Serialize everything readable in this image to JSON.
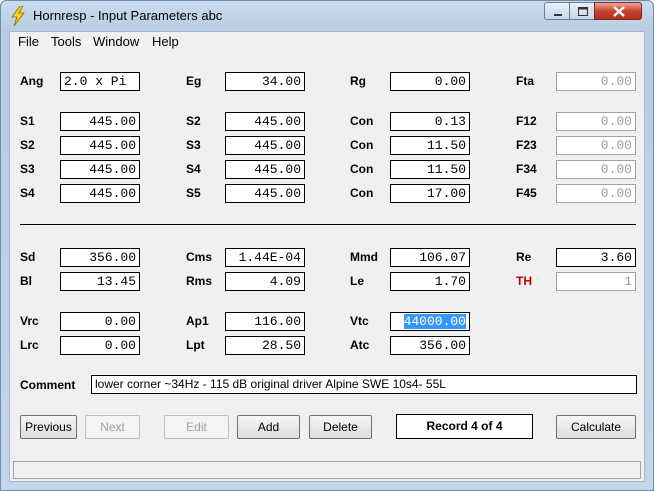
{
  "window": {
    "title": "Hornresp - Input Parameters   abc"
  },
  "menu": [
    "File",
    "Tools",
    "Window",
    "Help"
  ],
  "row_ang": {
    "ang_label": "Ang",
    "ang_value": "2.0 x Pi",
    "eg_label": "Eg",
    "eg_value": "34.00",
    "rg_label": "Rg",
    "rg_value": "0.00",
    "fta_label": "Fta",
    "fta_value": "0.00"
  },
  "rows": [
    {
      "a": "S1",
      "av": "445.00",
      "b": "S2",
      "bv": "445.00",
      "c": "Con",
      "cv": "0.13",
      "d": "F12",
      "dv": "0.00"
    },
    {
      "a": "S2",
      "av": "445.00",
      "b": "S3",
      "bv": "445.00",
      "c": "Con",
      "cv": "11.50",
      "d": "F23",
      "dv": "0.00"
    },
    {
      "a": "S3",
      "av": "445.00",
      "b": "S4",
      "bv": "445.00",
      "c": "Con",
      "cv": "11.50",
      "d": "F34",
      "dv": "0.00"
    },
    {
      "a": "S4",
      "av": "445.00",
      "b": "S5",
      "bv": "445.00",
      "c": "Con",
      "cv": "17.00",
      "d": "F45",
      "dv": "0.00"
    }
  ],
  "driver": {
    "sd_label": "Sd",
    "sd": "356.00",
    "cms_label": "Cms",
    "cms": "1.44E-04",
    "mmd_label": "Mmd",
    "mmd": "106.07",
    "re_label": "Re",
    "re": "3.60",
    "bl_label": "Bl",
    "bl": "13.45",
    "rms_label": "Rms",
    "rms": "4.09",
    "le_label": "Le",
    "le": "1.70",
    "th_label": "TH",
    "th": "1"
  },
  "chamber": {
    "vrc_label": "Vrc",
    "vrc": "0.00",
    "ap1_label": "Ap1",
    "ap1": "116.00",
    "vtc_label": "Vtc",
    "vtc": "44000.00",
    "lrc_label": "Lrc",
    "lrc": "0.00",
    "lpt_label": "Lpt",
    "lpt": "28.50",
    "atc_label": "Atc",
    "atc": "356.00"
  },
  "comment": {
    "label": "Comment",
    "value": "lower corner ~34Hz - 115 dB original driver Alpine SWE 10s4- 55L"
  },
  "buttons": {
    "previous": "Previous",
    "next": "Next",
    "edit": "Edit",
    "add": "Add",
    "delete": "Delete",
    "calculate": "Calculate"
  },
  "record": "Record 4 of 4",
  "colors": {
    "accent": "#3399ff",
    "th_label": "#c00000"
  }
}
